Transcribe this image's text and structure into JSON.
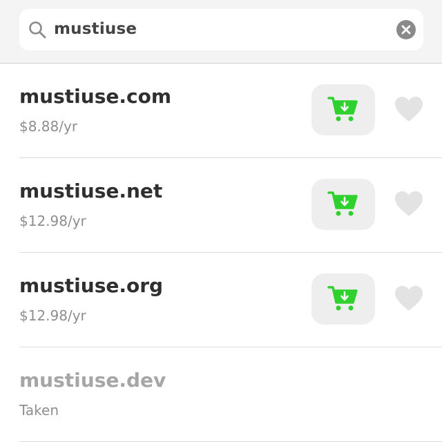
{
  "search": {
    "query": "mustiuse",
    "icon": "search-icon",
    "clear_icon": "clear-icon"
  },
  "results": [
    {
      "domain": "mustiuse.com",
      "price": "$8.88/yr",
      "available": true
    },
    {
      "domain": "mustiuse.net",
      "price": "$12.98/yr",
      "available": true
    },
    {
      "domain": "mustiuse.org",
      "price": "$12.98/yr",
      "available": true
    },
    {
      "domain": "mustiuse.dev",
      "price": "Taken",
      "available": false
    }
  ],
  "colors": {
    "accent_green": "#2fd12f",
    "heart_gray": "#e3e3e3",
    "text_dark": "#2f2f2f",
    "text_muted": "#8e8e8e"
  }
}
